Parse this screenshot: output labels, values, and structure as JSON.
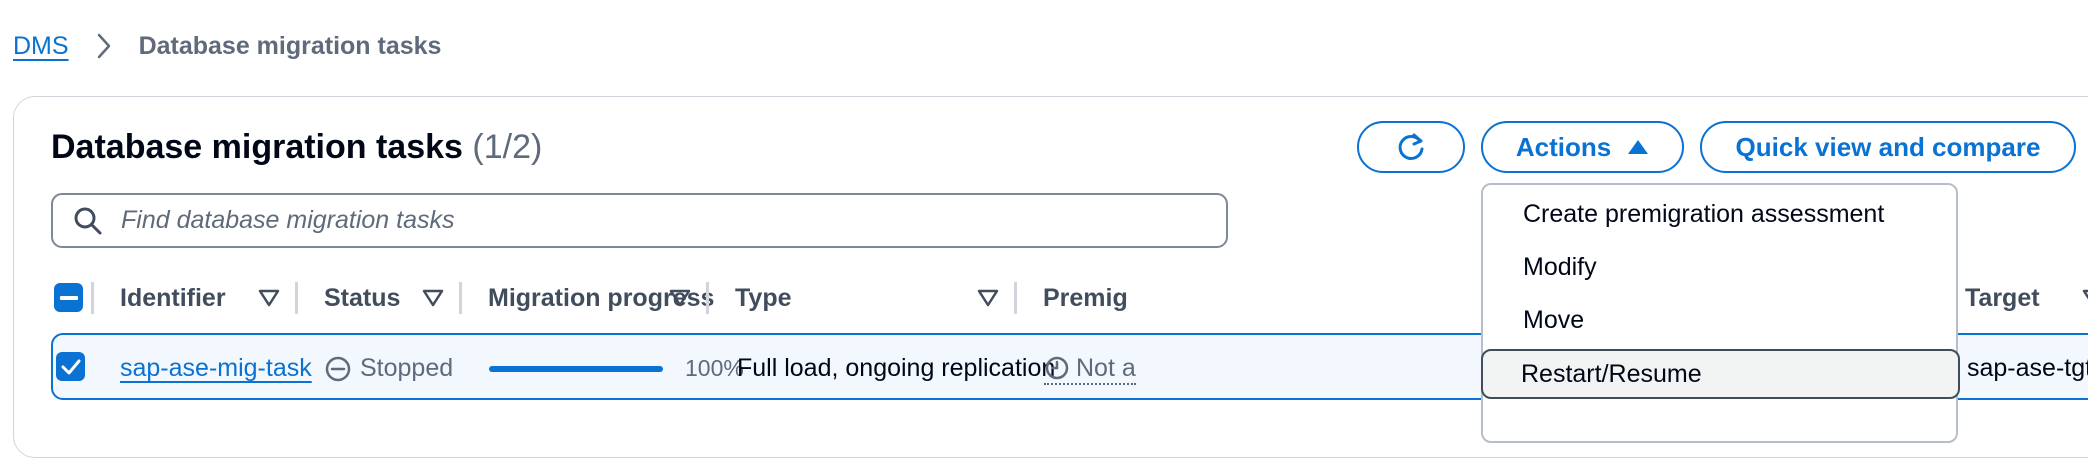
{
  "breadcrumb": {
    "root": "DMS",
    "current": "Database migration tasks"
  },
  "header": {
    "title": "Database migration tasks",
    "count": "(1/2)"
  },
  "toolbar": {
    "actions_label": "Actions",
    "quick_view_label": "Quick view and compare"
  },
  "search": {
    "placeholder": "Find database migration tasks"
  },
  "table": {
    "columns": [
      "Identifier",
      "Status",
      "Migration progress",
      "Type",
      "Premig",
      "Target"
    ],
    "rows": [
      {
        "selected": true,
        "identifier": "sap-ase-mig-task",
        "status": "Stopped",
        "progress": 1.0,
        "progress_label": "100%",
        "type": "Full load, ongoing replication",
        "premigration": "Not a",
        "target": "sap-ase-tgt"
      }
    ]
  },
  "actions_menu": {
    "items": [
      "Create premigration assessment",
      "Modify",
      "Move",
      "Restart/Resume"
    ],
    "highlighted": "Restart/Resume"
  },
  "colors": {
    "accent": "#0972d3",
    "muted": "#5f6b7a",
    "selected_row_bg": "#f2f8fd"
  },
  "icons": [
    "chevron-right-icon",
    "refresh-icon",
    "caret-up-icon",
    "search-icon",
    "sort-icon",
    "stopped-icon",
    "clock-icon"
  ]
}
